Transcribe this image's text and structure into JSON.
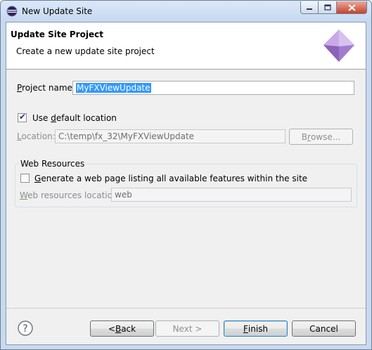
{
  "window": {
    "title": "New Update Site",
    "icon": "eclipse-icon"
  },
  "banner": {
    "title": "Update Site Project",
    "description": "Create a new update site project",
    "image": "wizard-diamond-icon"
  },
  "project": {
    "name_label_pre": "",
    "name_label_mn": "P",
    "name_label_post": "roject name:",
    "name_value": "MyFXViewUpdate"
  },
  "use_default_location": {
    "label_pre": "Use ",
    "label_mn": "d",
    "label_post": "efault location",
    "checked": true
  },
  "location": {
    "label_mn": "L",
    "label_post": "ocation:",
    "value": "C:\\temp\\fx_32\\MyFXViewUpdate",
    "browse_label_pre": "B",
    "browse_label_mn": "r",
    "browse_label_post": "owse..."
  },
  "web_resources": {
    "group_title": "Web Resources",
    "generate_label_mn": "G",
    "generate_label_post": "enerate a web page listing all available features within the site",
    "generate_checked": false,
    "location_label_mn": "W",
    "location_label_post": "eb resources location:",
    "location_value": "web"
  },
  "buttons": {
    "back_pre": "< ",
    "back_mn": "B",
    "back_post": "ack",
    "next": "Next >",
    "finish_mn": "F",
    "finish_post": "inish",
    "cancel": "Cancel"
  }
}
